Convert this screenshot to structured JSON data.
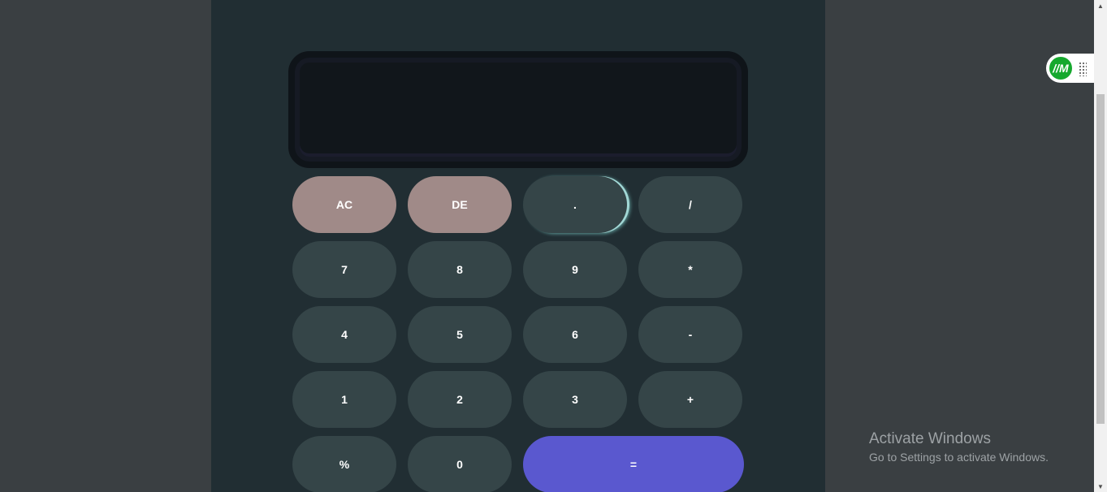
{
  "display": {
    "value": ""
  },
  "keypad": {
    "rows": [
      [
        "AC",
        "DE",
        ".",
        "/"
      ],
      [
        "7",
        "8",
        "9",
        "*"
      ],
      [
        "4",
        "5",
        "6",
        "-"
      ],
      [
        "1",
        "2",
        "3",
        "+"
      ],
      [
        "%",
        "0",
        "="
      ]
    ]
  },
  "extension": {
    "logo_text": "//M"
  },
  "watermark": {
    "title": "Activate Windows",
    "subtitle": "Go to Settings to activate Windows."
  },
  "colors": {
    "page_bg": "#3a3f42",
    "panel_bg": "#212e33",
    "key_bg": "#354548",
    "function_key_bg": "#a08a88",
    "equals_key_bg": "#5a58cf",
    "display_bg": "#11161b"
  },
  "icons": {
    "extension_logo": "extension-logo-icon",
    "drag_handle": "drag-handle-icon"
  }
}
